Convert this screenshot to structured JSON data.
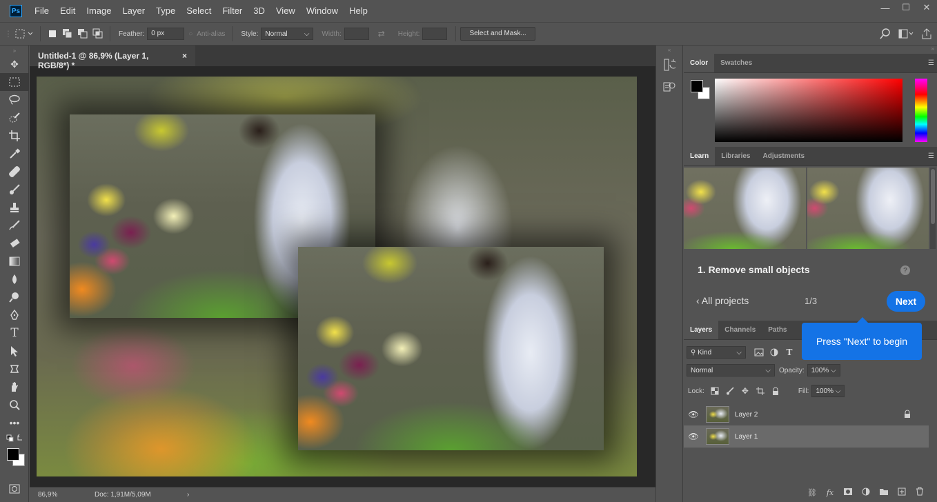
{
  "app": {
    "logo": "Ps"
  },
  "menu": [
    "File",
    "Edit",
    "Image",
    "Layer",
    "Type",
    "Select",
    "Filter",
    "3D",
    "View",
    "Window",
    "Help"
  ],
  "window_controls": {
    "minimize": "—",
    "maximize": "☐",
    "close": "✕"
  },
  "options": {
    "feather_label": "Feather:",
    "feather_value": "0 px",
    "antialias_label": "Anti-alias",
    "style_label": "Style:",
    "style_value": "Normal",
    "width_label": "Width:",
    "height_label": "Height:",
    "select_mask_label": "Select and Mask..."
  },
  "document": {
    "tab_title": "Untitled-1 @ 86,9% (Layer 1, RGB/8*) *",
    "tab_close": "×"
  },
  "status": {
    "zoom": "86,9%",
    "doc": "Doc: 1,91M/5,09M",
    "arrow": "›"
  },
  "color_panel": {
    "tabs": [
      "Color",
      "Swatches"
    ]
  },
  "learn_panel": {
    "tabs": [
      "Learn",
      "Libraries",
      "Adjustments"
    ],
    "step_title": "1.   Remove small objects",
    "help": "?",
    "all_projects": "‹  All projects",
    "step_count": "1/3",
    "next_label": "Next",
    "tooltip": "Press \"Next\" to begin"
  },
  "layers_panel": {
    "tabs": [
      "Layers",
      "Channels",
      "Paths"
    ],
    "kind_label": "Kind",
    "blend_mode": "Normal",
    "opacity_label": "Opacity:",
    "opacity_value": "100%",
    "lock_label": "Lock:",
    "fill_label": "Fill:",
    "fill_value": "100%",
    "layers": [
      {
        "name": "Layer 2",
        "locked": true
      },
      {
        "name": "Layer 1",
        "locked": false
      }
    ]
  }
}
